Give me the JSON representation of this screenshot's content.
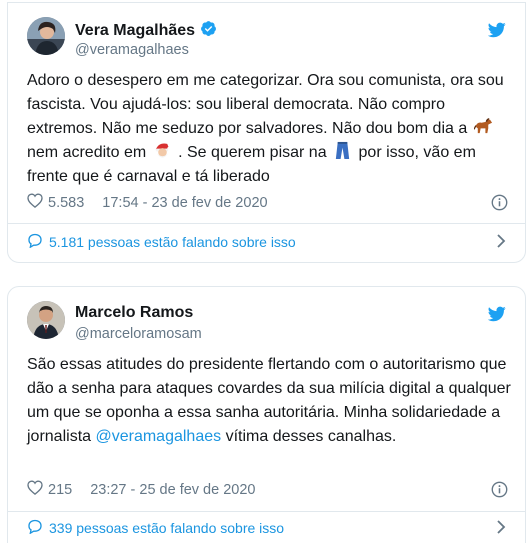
{
  "tweets": [
    {
      "name": "Vera Magalhães",
      "verified": true,
      "handle": "@veramagalhaes",
      "text_parts": {
        "p1": "Adoro o desespero em me categorizar. Ora sou comunista, ora sou fascista. Vou ajudá-los: sou liberal democrata. Não compro extremos. Não me seduzo por salvadores. Não dou bom dia a",
        "p2": "nem acredito em",
        "p3": ". Se querem pisar na",
        "p4": "por isso, vão em frente que é carnaval e tá liberado"
      },
      "emojis": [
        "horse-emoji",
        "santa-emoji",
        "jeans-emoji"
      ],
      "likes": "5.583",
      "time": "17:54 - 23 de fev de 2020",
      "talking": "5.181 pessoas estão falando sobre isso"
    },
    {
      "name": "Marcelo Ramos",
      "verified": false,
      "handle": "@marceloramosam",
      "text_parts": {
        "p1": "São essas atitudes do presidente flertando com o autoritarismo que dão a senha para ataques covardes da sua milícia digital a qualquer um que se oponha a essa sanha autoritária. Minha solidariedade a jornalista",
        "mention": "@veramagalhaes",
        "p2": "vítima desses canalhas."
      },
      "likes": "215",
      "time": "23:27 - 25 de fev de 2020",
      "talking": "339 pessoas estão falando sobre isso"
    }
  ],
  "colors": {
    "accent": "#1b95e0",
    "secondary": "#657786",
    "border": "#e1e8ed",
    "text": "#14171a"
  }
}
